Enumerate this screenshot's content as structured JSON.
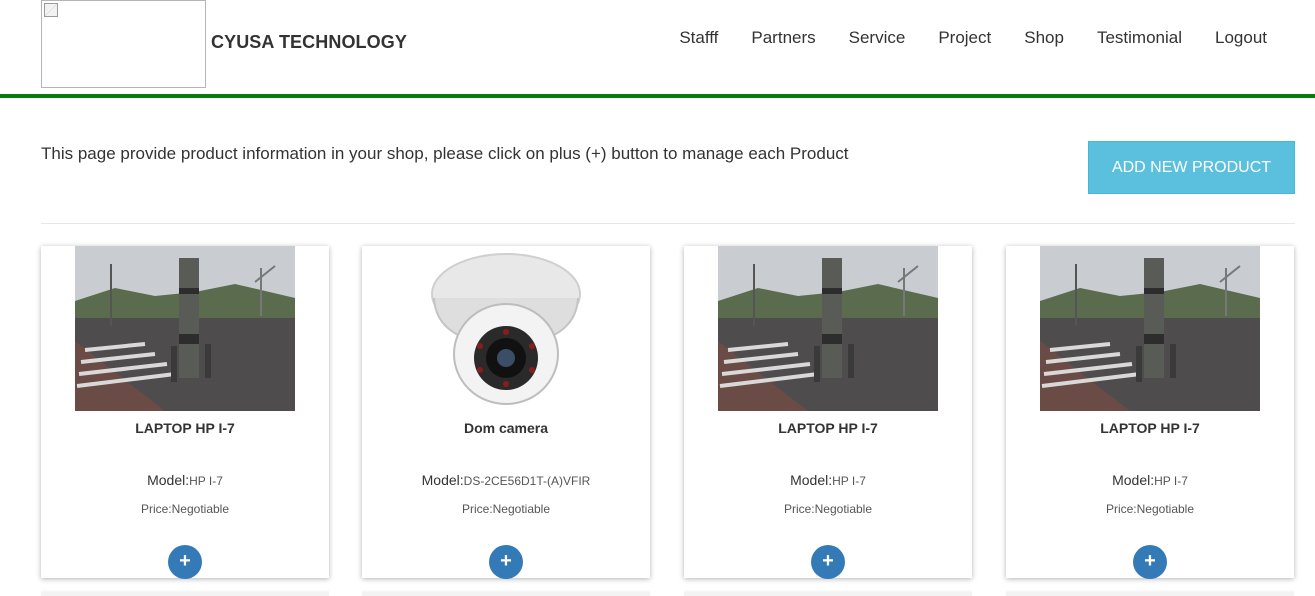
{
  "header": {
    "brand": "CYUSA TECHNOLOGY",
    "nav": [
      "Stafff",
      "Partners",
      "Service",
      "Project",
      "Shop",
      "Testimonial",
      "Logout"
    ]
  },
  "main": {
    "intro": "This page provide product information in your shop, please click on plus (+) button to manage each Product",
    "add_button": "ADD NEW PRODUCT"
  },
  "products": [
    {
      "title": "LAPTOP HP I-7",
      "model_label": "Model:",
      "model": "HP I-7",
      "price": "Price:Negotiable",
      "image": "street-photo"
    },
    {
      "title": "Dom camera",
      "model_label": "Model:",
      "model": "DS-2CE56D1T-(A)VFIR",
      "price": "Price:Negotiable",
      "image": "dome-camera"
    },
    {
      "title": "LAPTOP HP I-7",
      "model_label": "Model:",
      "model": "HP I-7",
      "price": "Price:Negotiable",
      "image": "street-photo"
    },
    {
      "title": "LAPTOP HP I-7",
      "model_label": "Model:",
      "model": "HP I-7",
      "price": "Price:Negotiable",
      "image": "street-photo"
    }
  ],
  "plus_icon": "+",
  "colors": {
    "accent_line": "#0a7a0a",
    "add_button": "#5bc0de",
    "plus_button": "#337ab7"
  }
}
